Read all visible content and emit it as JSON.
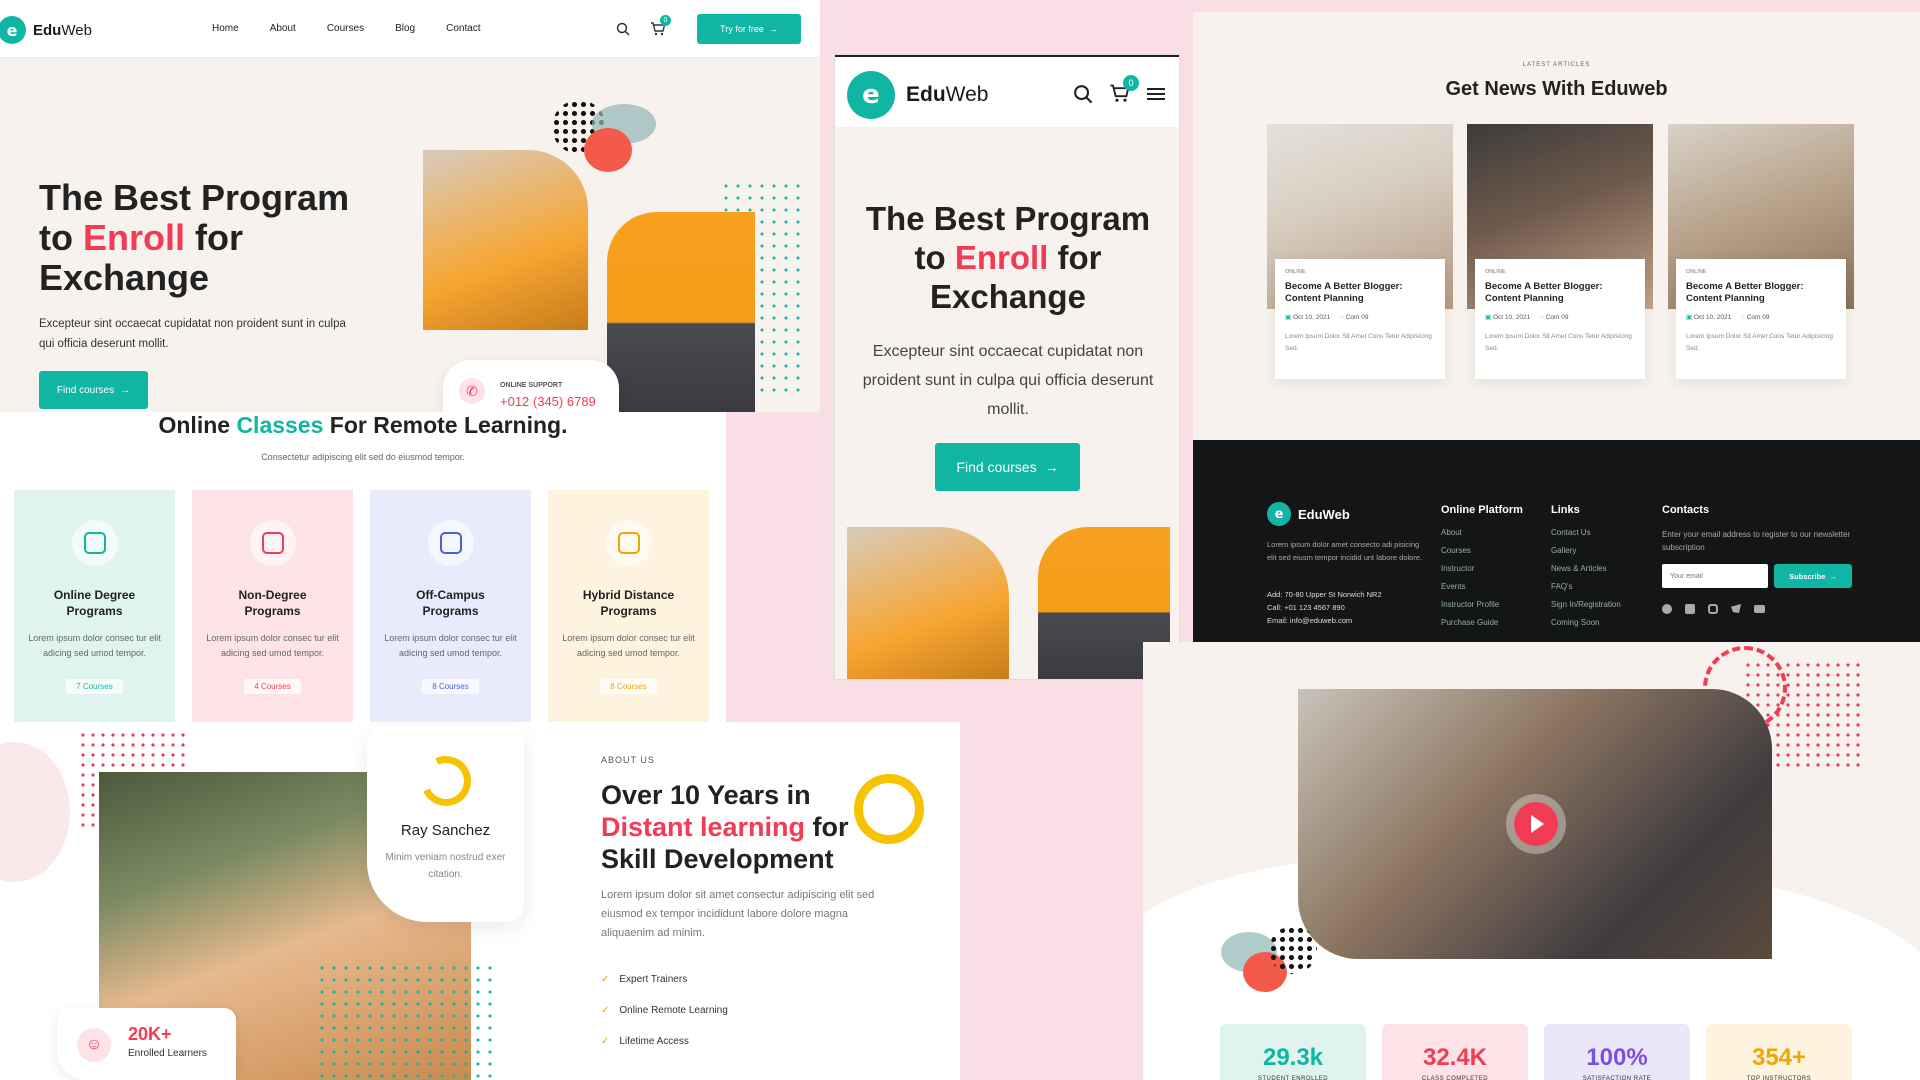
{
  "brand": {
    "name_a": "Edu",
    "name_b": "Web",
    "logo_letter": "e"
  },
  "nav": {
    "items": [
      "Home",
      "About",
      "Courses",
      "Blog",
      "Contact"
    ],
    "cart_count": "0",
    "cta": "Try for free"
  },
  "hero": {
    "line1": "The Best Program",
    "line2_a": "to ",
    "line2_b": "Enroll",
    "line2_c": " for",
    "line3": "Exchange",
    "desc": "Excepteur sint occaecat cupidatat non proident sunt in culpa qui officia deserunt mollit.",
    "cta": "Find courses",
    "support_label": "ONLINE SUPPORT",
    "support_phone": "+012 (345) 6789"
  },
  "classes": {
    "title_a": "Online ",
    "title_b": "Classes",
    "title_c": " For Remote Learning.",
    "subtitle": "Consectetur adipiscing elit sed do eiusmod tempor.",
    "cards": [
      {
        "title": "Online Degree Programs",
        "desc": "Lorem ipsum dolor consec tur elit adicing sed umod tempor.",
        "badge": "7 Courses",
        "bg": "#dff4ef",
        "accent": "#11b5a3"
      },
      {
        "title": "Non-Degree Programs",
        "desc": "Lorem ipsum dolor consec tur elit adicing sed umod tempor.",
        "badge": "4 Courses",
        "bg": "#fde3e8",
        "accent": "#f23b55"
      },
      {
        "title": "Off-Campus Programs",
        "desc": "Lorem ipsum dolor consec tur elit adicing sed umod tempor.",
        "badge": "8 Courses",
        "bg": "#e7ebfb",
        "accent": "#4a5fd8"
      },
      {
        "title": "Hybrid Distance Programs",
        "desc": "Lorem ipsum dolor consec tur elit adicing sed umod tempor.",
        "badge": "8 Courses",
        "bg": "#fdf3de",
        "accent": "#f0a500"
      }
    ]
  },
  "about": {
    "eyebrow": "ABOUT US",
    "line1": "Over 10 Years in",
    "line2_a": "Distant learning",
    "line2_b": " for",
    "line3": "Skill Development",
    "desc": "Lorem ipsum dolor sit amet consectur adipiscing elit sed eiusmod ex tempor incididunt labore dolore magna aliquaenim ad minim.",
    "checks": [
      "Expert Trainers",
      "Online Remote Learning",
      "Lifetime Access"
    ],
    "person_name": "Ray Sanchez",
    "person_desc": "Minim veniam nostrud exer citation.",
    "learners_num": "20K+",
    "learners_lbl": "Enrolled Learners"
  },
  "mobile": {
    "line1": "The Best Program",
    "line2_a": "to ",
    "line2_b": "Enroll",
    "line2_c": " for",
    "line3": "Exchange",
    "desc": "Excepteur sint occaecat cupidatat non proident sunt in culpa qui officia deserunt mollit.",
    "cta": "Find courses",
    "cart_count": "0"
  },
  "news": {
    "eyebrow": "LATEST ARTICLES",
    "title": "Get News With Eduweb",
    "articles": [
      {
        "cat": "ONLINE",
        "title": "Become A Better Blogger: Content Planning",
        "date": "Oct 10, 2021",
        "comments": "Com 09",
        "desc": "Lorem Ipsum Dolor Sit Amet Cons Tetur Adipisicing Sed."
      },
      {
        "cat": "ONLINE",
        "title": "Become A Better Blogger: Content Planning",
        "date": "Oct 10, 2021",
        "comments": "Com 09",
        "desc": "Lorem Ipsum Dolor Sit Amet Cons Tetur Adipisicing Sed."
      },
      {
        "cat": "ONLINE",
        "title": "Become A Better Blogger: Content Planning",
        "date": "Oct 10, 2021",
        "comments": "Com 09",
        "desc": "Lorem Ipsum Dolor Sit Amet Cons Tetur Adipisicing Sed."
      }
    ]
  },
  "footer": {
    "brand": "EduWeb",
    "about": "Lorem ipsum dolor amet consecto adi pisicing elit sed eiusm tempor incidid unt labore dolore.",
    "address": "Add: 70-80 Upper St Norwich NR2",
    "call": "Call: +01 123 4567 890",
    "email": "Email: info@eduweb.com",
    "col1_title": "Online Platform",
    "col1": [
      "About",
      "Courses",
      "Instructor",
      "Events",
      "Instructor Profile",
      "Purchase Guide"
    ],
    "col2_title": "Links",
    "col2": [
      "Contact Us",
      "Gallery",
      "News & Articles",
      "FAQ's",
      "Sign In/Registration",
      "Coming Soon"
    ],
    "col3_title": "Contacts",
    "col3_desc": "Enter your email address to register to our newsletter subscription",
    "email_placeholder": "Your email",
    "subscribe": "Subscribe"
  },
  "stats": [
    {
      "num": "29.3k",
      "lbl": "STUDENT ENROLLED",
      "color": "#11b5a3",
      "bg": "#dff4ef"
    },
    {
      "num": "32.4K",
      "lbl": "CLASS COMPLETED",
      "color": "#f23b55",
      "bg": "#fde3e8"
    },
    {
      "num": "100%",
      "lbl": "SATISFACTION RATE",
      "color": "#7b4fe0",
      "bg": "#ece6fb"
    },
    {
      "num": "354+",
      "lbl": "TOP INSTRUCTORS",
      "color": "#f0a500",
      "bg": "#fdf3de"
    }
  ]
}
